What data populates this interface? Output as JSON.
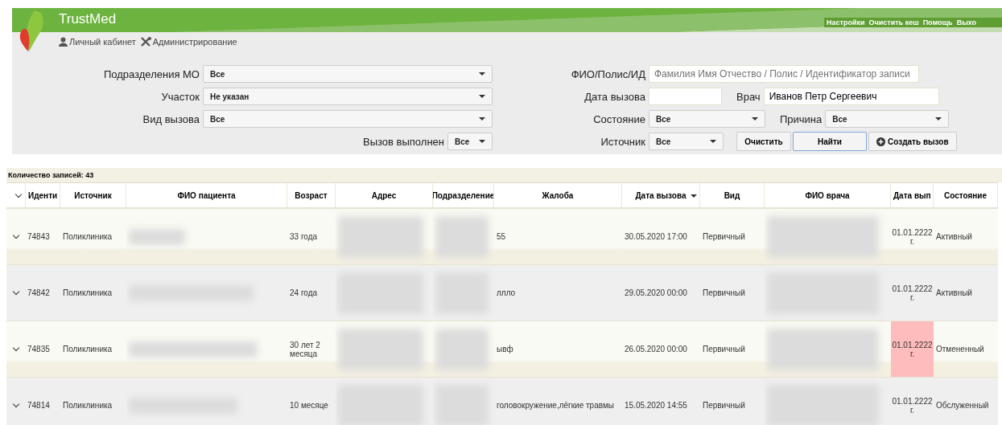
{
  "header": {
    "brand": "TrustMed",
    "links": [
      {
        "label": "Личный кабинет"
      },
      {
        "label": "Администрирование"
      }
    ],
    "top_links": [
      "Настройки",
      "Очистить кеш",
      "Помощь",
      "Выхо"
    ]
  },
  "filters_left": [
    {
      "label": "Подразделения МО",
      "value": "Все"
    },
    {
      "label": "Участок",
      "value": "Не указан"
    },
    {
      "label": "Вид вызова",
      "value": "Все"
    }
  ],
  "done_filter": {
    "label": "Вызов выполнен",
    "value": "Все"
  },
  "search": {
    "label": "ФИО/Полис/ИД",
    "placeholder": "Фамилия Имя Отчество / Полис / Идентификатор записи"
  },
  "call_date": {
    "label": "Дата вызова"
  },
  "doctor": {
    "label": "Врач",
    "value": "Иванов Петр Сергеевич"
  },
  "state": {
    "label": "Состояние",
    "value": "Все"
  },
  "reason": {
    "label": "Причина",
    "value": "Все"
  },
  "source": {
    "label": "Источник",
    "value": "Все"
  },
  "buttons": [
    {
      "label": "Очистить",
      "kind": "plain",
      "focused": false
    },
    {
      "label": "Найти",
      "kind": "plain",
      "focused": true
    },
    {
      "label": "Создать вызов",
      "kind": "create",
      "focused": false
    }
  ],
  "count": "Количество записей: 43",
  "table": {
    "columns": [
      {
        "label": "Иденти",
        "sorted": false
      },
      {
        "label": "Источник",
        "sorted": false
      },
      {
        "label": "ФИО пациента",
        "sorted": false
      },
      {
        "label": "Возраст",
        "sorted": false
      },
      {
        "label": "Адрес",
        "sorted": false
      },
      {
        "label": "Подразделение",
        "sorted": false
      },
      {
        "label": "Жалоба",
        "sorted": false
      },
      {
        "label": "Дата вызова",
        "sorted": true
      },
      {
        "label": "Вид",
        "sorted": false
      },
      {
        "label": "ФИО врача",
        "sorted": false
      },
      {
        "label": "Дата вып",
        "sorted": false
      },
      {
        "label": "Состояние",
        "sorted": false
      }
    ],
    "rows": [
      {
        "id": "74843",
        "source": "Поликлиника",
        "age": "33 года",
        "complaint": "55",
        "date": "30.05.2020 17:00",
        "kind": "Первичный",
        "done_date": "01.01.2222 г.",
        "highlighted": false,
        "state": "Активный"
      },
      {
        "id": "74842",
        "source": "Поликлиника",
        "age": "24 года",
        "complaint": "ллло",
        "date": "29.05.2020 00:00",
        "kind": "Первичный",
        "done_date": "01.01.2222 г.",
        "highlighted": false,
        "state": "Активный"
      },
      {
        "id": "74835",
        "source": "Поликлиника",
        "age": "30 лет 2 месяца",
        "complaint": "ывф",
        "date": "26.05.2020 00:00",
        "kind": "Первичный",
        "done_date": "01.01.2222 г.",
        "highlighted": true,
        "state": "Отмененный"
      },
      {
        "id": "74814",
        "source": "Поликлиника",
        "age": "10 месяце",
        "complaint": "головокружение,лёгкие травмы",
        "date": "15.05.2020 14:55",
        "kind": "Первичный",
        "done_date": "01.01.2222 г.",
        "highlighted": false,
        "state": "Обслуженный"
      }
    ]
  }
}
